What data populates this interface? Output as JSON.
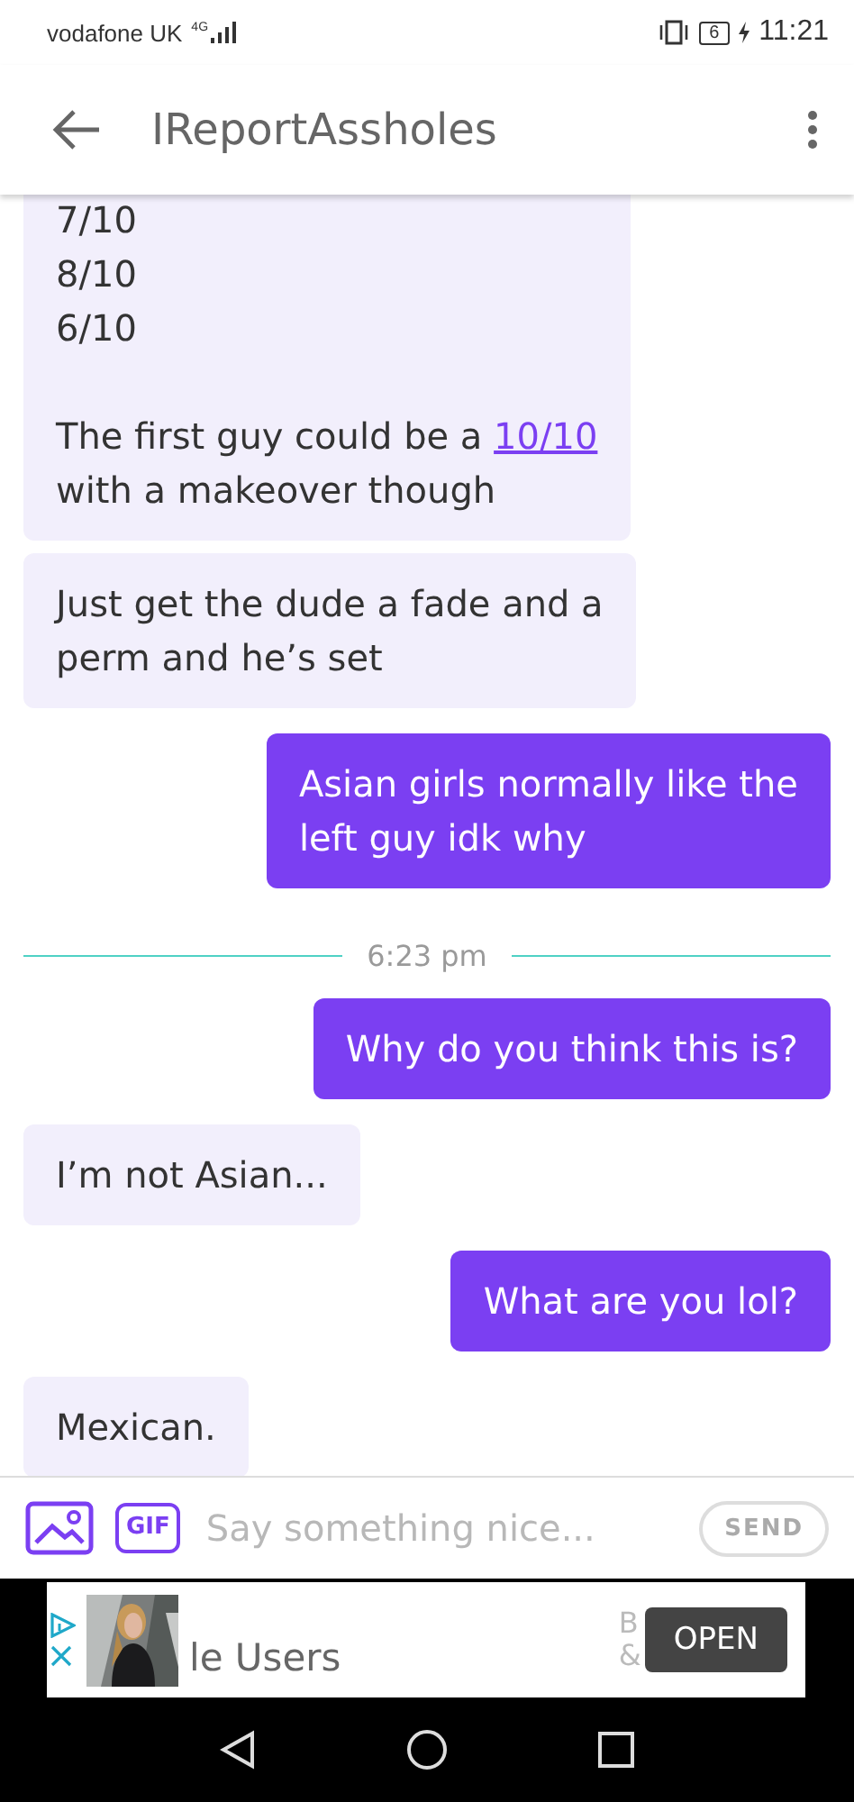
{
  "status_bar": {
    "carrier": "vodafone UK",
    "network": "4G",
    "battery": "6",
    "time": "11:21"
  },
  "header": {
    "title": "IReportAssholes"
  },
  "messages": [
    {
      "kind": "message",
      "sent": false,
      "segments": [
        {
          "kind": "text",
          "text": "7/10\n8/10\n6/10\n\nThe first guy could be a "
        },
        {
          "kind": "link",
          "text": "10/10"
        },
        {
          "kind": "text",
          "text": "\nwith a makeover though"
        }
      ]
    },
    {
      "kind": "message",
      "sent": false,
      "segments": [
        {
          "kind": "text",
          "text": "Just get the dude a fade and a\nperm and he’s set"
        }
      ]
    },
    {
      "kind": "message",
      "sent": true,
      "segments": [
        {
          "kind": "text",
          "text": "Asian girls normally like the\nleft guy idk why"
        }
      ]
    },
    {
      "kind": "divider",
      "text": "6:23 pm"
    },
    {
      "kind": "message",
      "sent": true,
      "segments": [
        {
          "kind": "text",
          "text": "Why do you think this is?"
        }
      ]
    },
    {
      "kind": "message",
      "sent": false,
      "segments": [
        {
          "kind": "text",
          "text": "I’m not Asian..."
        }
      ]
    },
    {
      "kind": "message",
      "sent": true,
      "segments": [
        {
          "kind": "text",
          "text": "What are you lol?"
        }
      ]
    },
    {
      "kind": "message",
      "sent": false,
      "segments": [
        {
          "kind": "text",
          "text": "Mexican."
        }
      ]
    }
  ],
  "composer": {
    "gif_label": "GIF",
    "placeholder": "Say something nice...",
    "send_label": "SEND"
  },
  "ad": {
    "kind": "picture",
    "headline": "le Users",
    "fragment_1": "B",
    "fragment_2": "&",
    "button": "OPEN"
  }
}
